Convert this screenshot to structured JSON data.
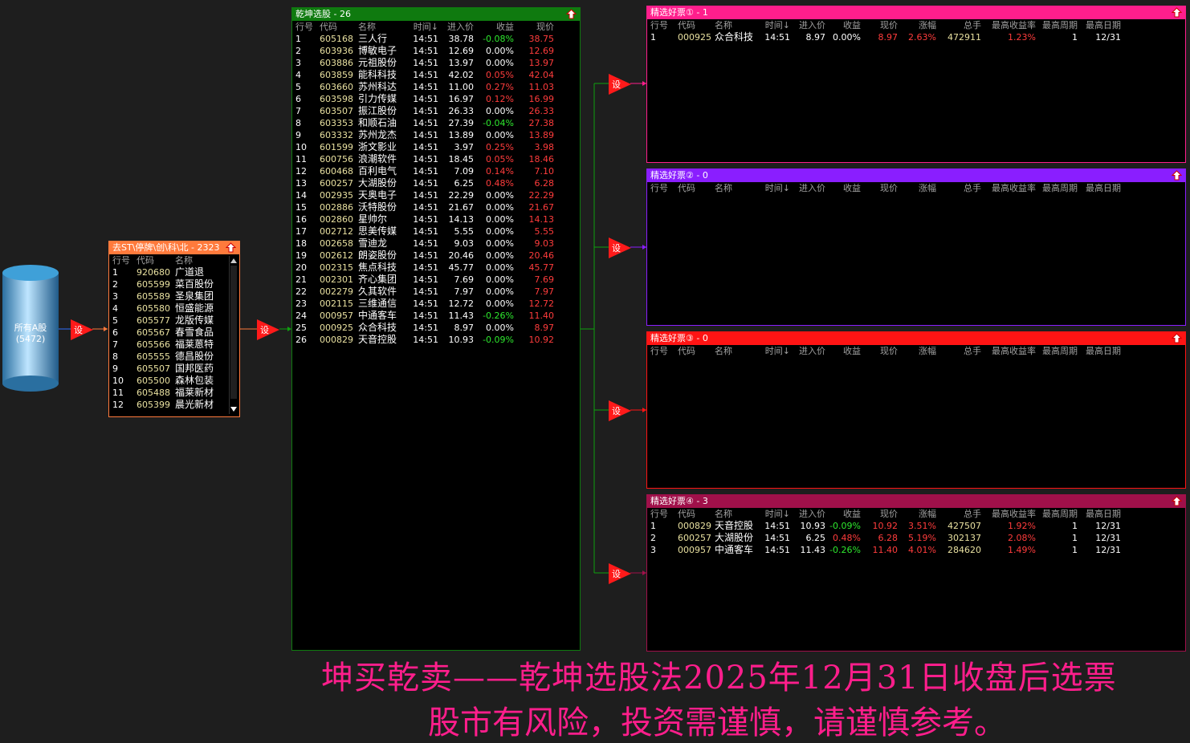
{
  "source": {
    "label": "所有A股",
    "count": "(5472)"
  },
  "set_label": "设",
  "filter": {
    "title": "去ST\\停牌\\创\\科\\北 - 2323",
    "headers": [
      "行号",
      "代码",
      "名称"
    ],
    "rows": [
      [
        "1",
        "920680",
        "广道退"
      ],
      [
        "2",
        "605599",
        "菜百股份"
      ],
      [
        "3",
        "605589",
        "圣泉集团"
      ],
      [
        "4",
        "605580",
        "恒盛能源"
      ],
      [
        "5",
        "605577",
        "龙版传媒"
      ],
      [
        "6",
        "605567",
        "春雪食品"
      ],
      [
        "7",
        "605566",
        "福莱蒽特"
      ],
      [
        "8",
        "605555",
        "德昌股份"
      ],
      [
        "9",
        "605507",
        "国邦医药"
      ],
      [
        "10",
        "605500",
        "森林包装"
      ],
      [
        "11",
        "605488",
        "福莱新材"
      ],
      [
        "12",
        "605399",
        "晨光新材"
      ]
    ],
    "color": "#ff7a3c"
  },
  "main": {
    "title": "乾坤选股 - 26",
    "headers": [
      "行号",
      "代码",
      "名称",
      "时间↓",
      "进入价",
      "收益",
      "现价"
    ],
    "rows": [
      [
        "1",
        "605168",
        "三人行",
        "14:51",
        "38.78",
        "-0.08%",
        "38.75"
      ],
      [
        "2",
        "603936",
        "博敏电子",
        "14:51",
        "12.69",
        "0.00%",
        "12.69"
      ],
      [
        "3",
        "603886",
        "元祖股份",
        "14:51",
        "13.97",
        "0.00%",
        "13.97"
      ],
      [
        "4",
        "603859",
        "能科科技",
        "14:51",
        "42.02",
        "0.05%",
        "42.04"
      ],
      [
        "5",
        "603660",
        "苏州科达",
        "14:51",
        "11.00",
        "0.27%",
        "11.03"
      ],
      [
        "6",
        "603598",
        "引力传媒",
        "14:51",
        "16.97",
        "0.12%",
        "16.99"
      ],
      [
        "7",
        "603507",
        "振江股份",
        "14:51",
        "26.33",
        "0.00%",
        "26.33"
      ],
      [
        "8",
        "603353",
        "和顺石油",
        "14:51",
        "27.39",
        "-0.04%",
        "27.38"
      ],
      [
        "9",
        "603332",
        "苏州龙杰",
        "14:51",
        "13.89",
        "0.00%",
        "13.89"
      ],
      [
        "10",
        "601599",
        "浙文影业",
        "14:51",
        "3.97",
        "0.25%",
        "3.98"
      ],
      [
        "11",
        "600756",
        "浪潮软件",
        "14:51",
        "18.45",
        "0.05%",
        "18.46"
      ],
      [
        "12",
        "600468",
        "百利电气",
        "14:51",
        "7.09",
        "0.14%",
        "7.10"
      ],
      [
        "13",
        "600257",
        "大湖股份",
        "14:51",
        "6.25",
        "0.48%",
        "6.28"
      ],
      [
        "14",
        "002935",
        "天奥电子",
        "14:51",
        "22.29",
        "0.00%",
        "22.29"
      ],
      [
        "15",
        "002886",
        "沃特股份",
        "14:51",
        "21.67",
        "0.00%",
        "21.67"
      ],
      [
        "16",
        "002860",
        "星帅尔",
        "14:51",
        "14.13",
        "0.00%",
        "14.13"
      ],
      [
        "17",
        "002712",
        "思美传媒",
        "14:51",
        "5.55",
        "0.00%",
        "5.55"
      ],
      [
        "18",
        "002658",
        "雪迪龙",
        "14:51",
        "9.03",
        "0.00%",
        "9.03"
      ],
      [
        "19",
        "002612",
        "朗姿股份",
        "14:51",
        "20.46",
        "0.00%",
        "20.46"
      ],
      [
        "20",
        "002315",
        "焦点科技",
        "14:51",
        "45.77",
        "0.00%",
        "45.77"
      ],
      [
        "21",
        "002301",
        "齐心集团",
        "14:51",
        "7.69",
        "0.00%",
        "7.69"
      ],
      [
        "22",
        "002279",
        "久其软件",
        "14:51",
        "7.97",
        "0.00%",
        "7.97"
      ],
      [
        "23",
        "002115",
        "三维通信",
        "14:51",
        "12.72",
        "0.00%",
        "12.72"
      ],
      [
        "24",
        "000957",
        "中通客车",
        "14:51",
        "11.43",
        "-0.26%",
        "11.40"
      ],
      [
        "25",
        "000925",
        "众合科技",
        "14:51",
        "8.97",
        "0.00%",
        "8.97"
      ],
      [
        "26",
        "000829",
        "天音控股",
        "14:51",
        "10.93",
        "-0.09%",
        "10.92"
      ]
    ],
    "color": "#0f7a0f"
  },
  "picks_headers": [
    "行号",
    "代码",
    "名称",
    "时间↓",
    "进入价",
    "收益",
    "现价",
    "涨幅",
    "总手",
    "最高收益率",
    "最高周期",
    "最高日期"
  ],
  "picks": [
    {
      "title": "精选好票① - 1",
      "color": "#ff1e8c",
      "rows": [
        [
          "1",
          "000925",
          "众合科技",
          "14:51",
          "8.97",
          "0.00%",
          "8.97",
          "2.63%",
          "472911",
          "1.23%",
          "1",
          "12/31"
        ]
      ]
    },
    {
      "title": "精选好票② - 0",
      "color": "#8a1eff",
      "rows": []
    },
    {
      "title": "精选好票③ - 0",
      "color": "#ff1414",
      "rows": []
    },
    {
      "title": "精选好票④ - 3",
      "color": "#a0104a",
      "rows": [
        [
          "1",
          "000829",
          "天音控股",
          "14:51",
          "10.93",
          "-0.09%",
          "10.92",
          "3.51%",
          "427507",
          "1.92%",
          "1",
          "12/31"
        ],
        [
          "2",
          "600257",
          "大湖股份",
          "14:51",
          "6.25",
          "0.48%",
          "6.28",
          "5.19%",
          "302137",
          "2.08%",
          "1",
          "12/31"
        ],
        [
          "3",
          "000957",
          "中通客车",
          "14:51",
          "11.43",
          "-0.26%",
          "11.40",
          "4.01%",
          "284620",
          "1.49%",
          "1",
          "12/31"
        ]
      ]
    }
  ],
  "footer": {
    "line1": "坤买乾卖——乾坤选股法2025年12月31日收盘后选票",
    "line2": "股市有风险，投资需谨慎，请谨慎参考。"
  }
}
